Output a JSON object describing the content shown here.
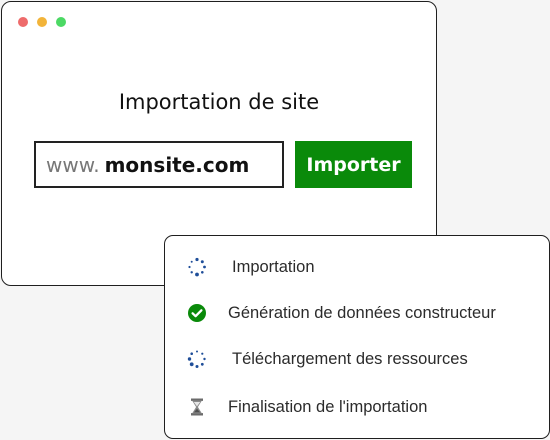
{
  "window": {
    "controls": [
      "close",
      "minimize",
      "maximize"
    ],
    "control_colors": [
      "#ee6b6b",
      "#f2b43a",
      "#4cd964"
    ]
  },
  "importer": {
    "title": "Importation de site",
    "url_prefix": "www.",
    "url_value": "monsite.com",
    "button_label": "Importer",
    "button_color": "#0a8a0a"
  },
  "status": {
    "steps": [
      {
        "label": "Importation",
        "state": "in-progress",
        "icon": "spinner-icon"
      },
      {
        "label": "Génération de données constructeur",
        "state": "done",
        "icon": "check-circle-icon"
      },
      {
        "label": "Téléchargement des ressources",
        "state": "in-progress",
        "icon": "spinner-icon"
      },
      {
        "label": "Finalisation de l'importation",
        "state": "pending",
        "icon": "hourglass-icon"
      }
    ],
    "colors": {
      "spinner": "#1f4e99",
      "done": "#0a8a0a",
      "pending": "#6b6b6b"
    }
  }
}
